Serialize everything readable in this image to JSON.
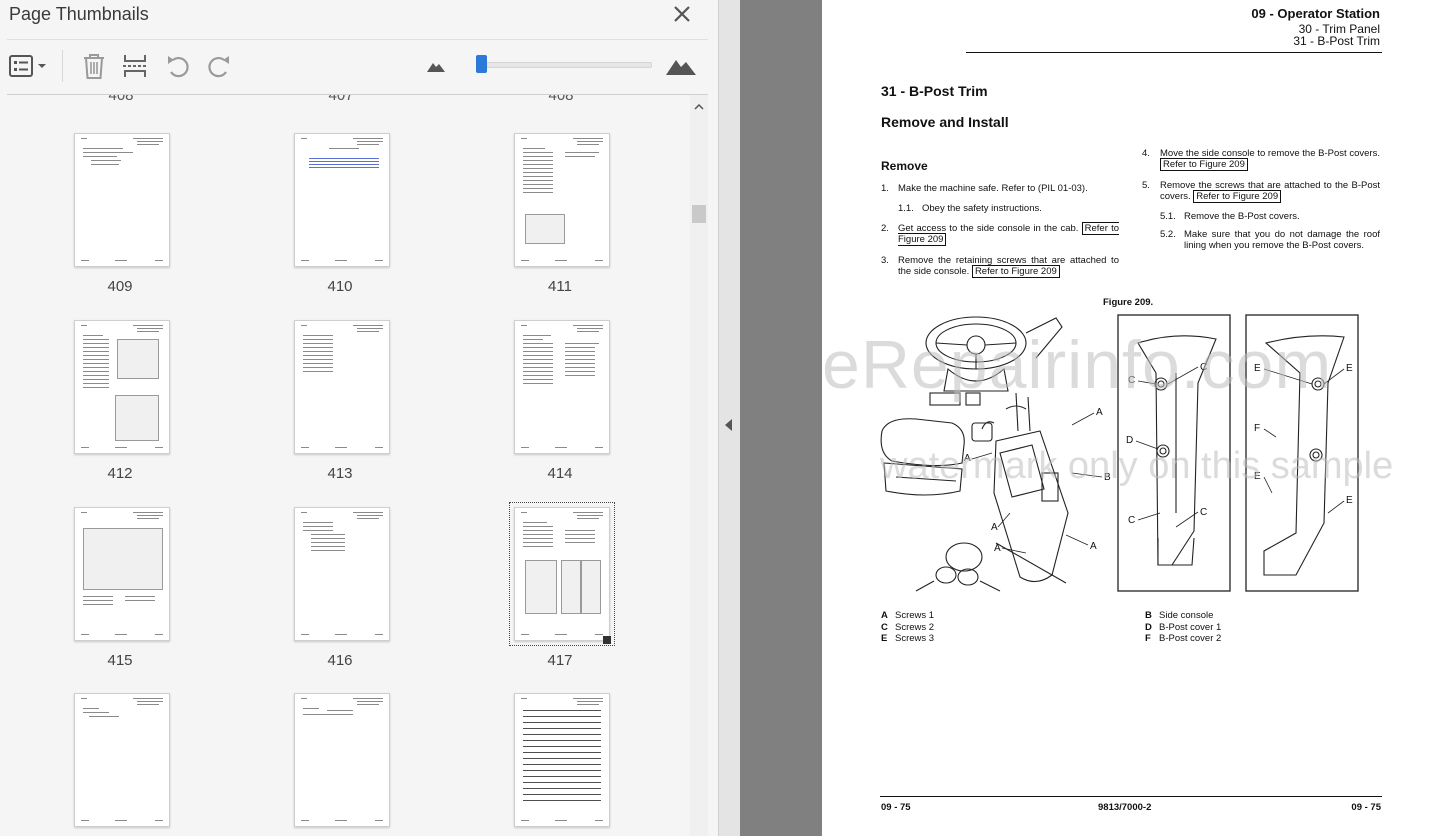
{
  "thumbnails_panel": {
    "title": "Page Thumbnails",
    "close_icon": "close-icon",
    "toolbar": {
      "options_icon": "thumbnail-options-icon",
      "delete_icon": "trash-icon",
      "extract_icon": "extract-pages-icon",
      "rotate_ccw_icon": "rotate-counterclockwise-icon",
      "rotate_cw_icon": "rotate-clockwise-icon",
      "zoom_out_icon": "small-mountain-icon",
      "zoom_in_icon": "large-mountain-icon",
      "zoom_level": 0.03
    },
    "partial_top_labels": [
      "408",
      "407",
      "408"
    ],
    "thumbnails": [
      {
        "label": "409"
      },
      {
        "label": "410"
      },
      {
        "label": "411"
      },
      {
        "label": "412"
      },
      {
        "label": "413"
      },
      {
        "label": "414"
      },
      {
        "label": "415"
      },
      {
        "label": "416"
      },
      {
        "label": "417",
        "selected": true
      },
      {
        "label": ""
      },
      {
        "label": ""
      },
      {
        "label": ""
      }
    ]
  },
  "document": {
    "header": {
      "section": "09 - Operator Station",
      "sub1": "30 - Trim Panel",
      "sub2": "31 - B-Post Trim"
    },
    "title": "31 - B-Post Trim",
    "subtitle": "Remove and Install",
    "remove_heading": "Remove",
    "steps_left": [
      {
        "num": "1.",
        "text": "Make the machine safe. Refer to (PIL 01-03)."
      },
      {
        "num": "1.1.",
        "text": "Obey the safety instructions."
      },
      {
        "num": "2.",
        "text": "Get access to the side console in the cab.",
        "ref": "Refer to Figure 209"
      },
      {
        "num": "3.",
        "text": "Remove the retaining screws that are attached to the side console.",
        "ref": "Refer to Figure 209"
      }
    ],
    "steps_right": [
      {
        "num": "4.",
        "text": "Move the side console to remove the B-Post covers.",
        "ref": "Refer to Figure 209"
      },
      {
        "num": "5.",
        "text": "Remove the screws that are attached to the B-Post covers.",
        "ref": "Refer to Figure 209"
      },
      {
        "num": "5.1.",
        "text": "Remove the B-Post covers."
      },
      {
        "num": "5.2.",
        "text": "Make sure that you do not damage the roof lining when you remove the B-Post covers."
      }
    ],
    "figure_label": "Figure 209.",
    "figure_callouts": [
      "A",
      "A",
      "A",
      "A",
      "A",
      "B",
      "C",
      "C",
      "C",
      "C",
      "D",
      "E",
      "E",
      "E",
      "E",
      "F"
    ],
    "legend_left": [
      {
        "key": "A",
        "value": "Screws 1"
      },
      {
        "key": "C",
        "value": "Screws 2"
      },
      {
        "key": "E",
        "value": "Screws 3"
      }
    ],
    "legend_right": [
      {
        "key": "B",
        "value": "Side console"
      },
      {
        "key": "D",
        "value": "B-Post cover 1"
      },
      {
        "key": "F",
        "value": "B-Post cover 2"
      }
    ],
    "footer": {
      "left": "09 - 75",
      "center": "9813/7000-2",
      "right": "09 - 75"
    },
    "watermark_1": "eRepairinfo.com",
    "watermark_2": "watermark only on this sample"
  },
  "colors": {
    "accent": "#2b7ad8",
    "panel_bg": "#f5f5f5",
    "viewer_gray": "#808080"
  }
}
